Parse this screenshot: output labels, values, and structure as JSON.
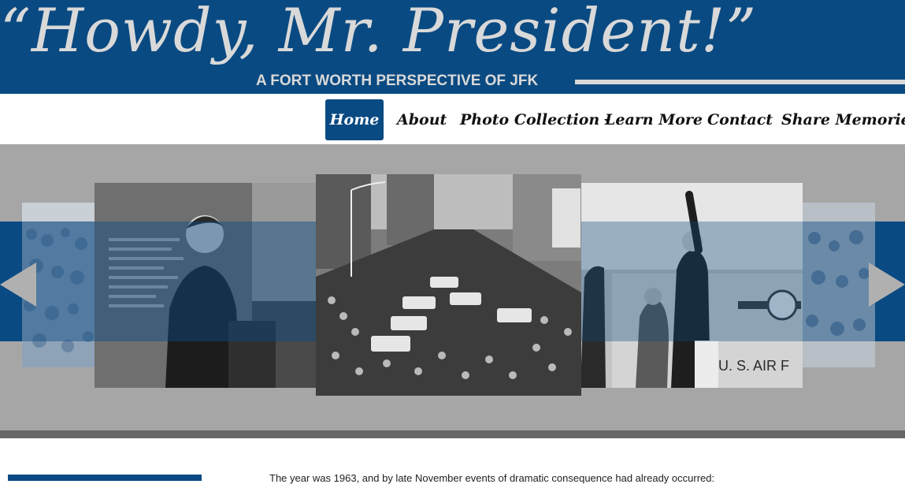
{
  "header": {
    "title": "“Howdy, Mr. President!”",
    "tagline": "A FORT WORTH PERSPECTIVE OF JFK"
  },
  "nav": {
    "items": [
      {
        "label": "Home",
        "active": true
      },
      {
        "label": "About"
      },
      {
        "label": "Photo Collection",
        "dropdown": true
      },
      {
        "label": "Learn More"
      },
      {
        "label": "Contact"
      },
      {
        "label": "Share Memories"
      }
    ]
  },
  "carousel": {
    "slides": [
      {
        "name": "crowd-far-left",
        "caption": ""
      },
      {
        "name": "jfk-speech-podium",
        "caption": ""
      },
      {
        "name": "motorcade-street-crowd",
        "caption": ""
      },
      {
        "name": "jfk-waving-air-force-one",
        "caption": ""
      },
      {
        "name": "crowd-far-right",
        "caption": ""
      }
    ],
    "controls": {
      "prev": "prev-arrow",
      "next": "next-arrow"
    }
  },
  "content": {
    "intro_text": "The year was 1963, and by late November events of dramatic consequence had already occurred:"
  },
  "colors": {
    "brand_blue": "#0a4a82",
    "title_gray": "#d9d9d9",
    "carousel_bg": "#a6a6a6"
  }
}
